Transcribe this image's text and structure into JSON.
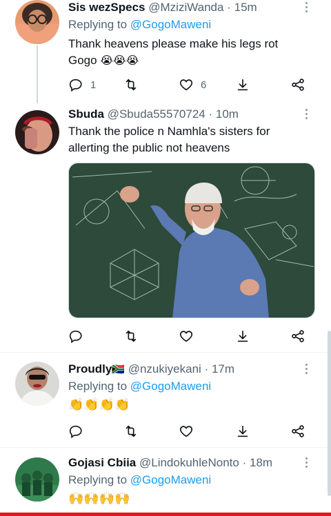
{
  "tweets": [
    {
      "name": "Sis wezSpecs",
      "handle": "@MziziWanda",
      "time": "15m",
      "replying_prefix": "Replying to ",
      "replying_to": "@GogoMaweni",
      "text_line1": "Thank heavens please make his legs rot",
      "text_line2": "Gogo",
      "emojis": "😭😭😭",
      "reply_count": "1",
      "retweet_count": "",
      "like_count": "6"
    },
    {
      "name": "Sbuda",
      "handle": "@Sbuda55570724",
      "time": "10m",
      "text_line1": "Thank the police n Namhla's sisters for",
      "text_line2": "allerting the public not heavens",
      "media_alt": "Man in blue shirt pointing at chalkboard with geometric diagrams"
    },
    {
      "name": "Proudly",
      "flag": "🇿🇦",
      "handle": "@nzukiyekani",
      "time": "17m",
      "replying_prefix": "Replying to ",
      "replying_to": "@GogoMaweni",
      "emojis": "👏👏👏👏"
    },
    {
      "name": "Gojasi Cbiia",
      "handle": "@LindokuhleNonto",
      "time": "18m",
      "replying_prefix": "Replying to ",
      "replying_to": "@GogoMaweni",
      "emojis": "🙌🙌🙌🙌"
    }
  ],
  "separator": "·",
  "icons": {
    "reply": "reply-icon",
    "retweet": "retweet-icon",
    "like": "heart-icon",
    "bookmark": "bookmark-icon",
    "share": "share-icon",
    "more": "more-icon"
  },
  "colors": {
    "link": "#1d9bf0",
    "muted": "#536471",
    "accent_bar": "#e0171f",
    "chalkboard": "#2d4a3a"
  }
}
